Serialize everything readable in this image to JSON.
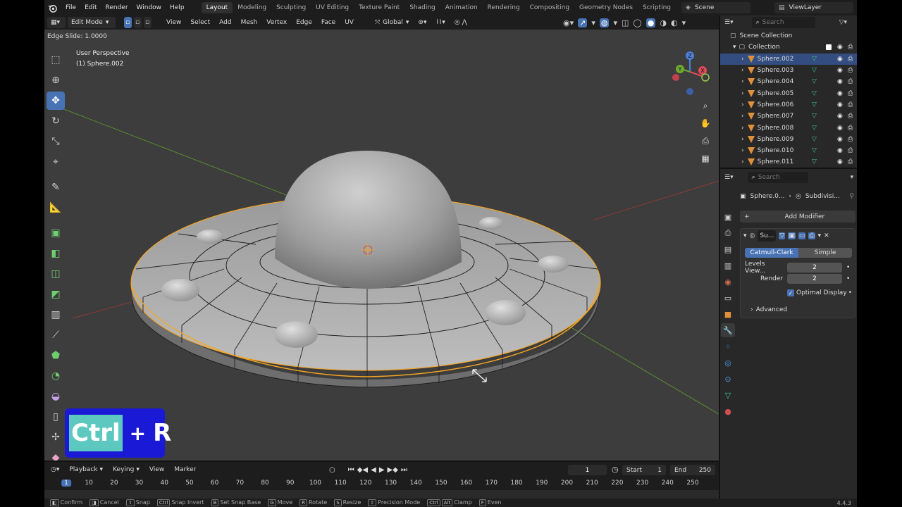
{
  "app": {
    "menus": [
      "File",
      "Edit",
      "Render",
      "Window",
      "Help"
    ],
    "workspace_tabs": [
      "Layout",
      "Modeling",
      "Sculpting",
      "UV Editing",
      "Texture Paint",
      "Shading",
      "Animation",
      "Rendering",
      "Compositing",
      "Geometry Nodes",
      "Scripting"
    ],
    "active_tab": "Layout",
    "add_tab_label": "+",
    "scene": "Scene",
    "view_layer": "ViewLayer"
  },
  "viewport_header": {
    "mode": "Edit Mode",
    "menus": [
      "View",
      "Select",
      "Add",
      "Mesh",
      "Vertex",
      "Edge",
      "Face",
      "UV"
    ],
    "orientation": "Global"
  },
  "viewport": {
    "operator_status": "Edge Slide: 1.0000",
    "perspective": "User Perspective",
    "object_info": "(1) Sphere.002",
    "gizmo_axes": [
      "X",
      "Y",
      "Z"
    ]
  },
  "shortcut_overlay": {
    "key1": "Ctrl",
    "plus": "+",
    "key2": "R"
  },
  "outliner": {
    "search_placeholder": "Search",
    "scene_collection": "Scene Collection",
    "collection": "Collection",
    "objects": [
      "Sphere.002",
      "Sphere.003",
      "Sphere.004",
      "Sphere.005",
      "Sphere.006",
      "Sphere.007",
      "Sphere.008",
      "Sphere.009",
      "Sphere.010",
      "Sphere.011"
    ],
    "selected_object": "Sphere.002"
  },
  "properties": {
    "search_placeholder": "Search",
    "breadcrumb_object": "Sphere.0...",
    "breadcrumb_modifier": "Subdivisi...",
    "add_modifier": "Add Modifier",
    "modifier_name": "Su...",
    "algorithm_options": [
      "Catmull-Clark",
      "Simple"
    ],
    "algorithm_selected": "Catmull-Clark",
    "levels_viewport_label": "Levels View...",
    "levels_viewport": "2",
    "render_label": "Render",
    "render_levels": "2",
    "optimal_display_label": "Optimal Display",
    "optimal_display_checked": true,
    "advanced_label": "Advanced"
  },
  "timeline": {
    "menus": [
      "Playback",
      "Keying",
      "View",
      "Marker"
    ],
    "current_frame": "1",
    "start_label": "Start",
    "start": "1",
    "end_label": "End",
    "end": "250",
    "ruler_ticks": [
      "1",
      "10",
      "20",
      "30",
      "40",
      "50",
      "60",
      "70",
      "80",
      "90",
      "100",
      "110",
      "120",
      "130",
      "140",
      "150",
      "160",
      "170",
      "180",
      "190",
      "200",
      "210",
      "220",
      "230",
      "240",
      "250"
    ]
  },
  "status_bar": {
    "items": [
      "Confirm",
      "Cancel",
      "Snap",
      "Snap Invert",
      "Set Snap Base",
      "Move",
      "Rotate",
      "Resize",
      "Precision Mode",
      "Clamp",
      "Even"
    ],
    "keys": [
      "Ctrl",
      "B",
      "Ctrl",
      "Alt",
      "F"
    ],
    "version": "4.4.3"
  },
  "colors": {
    "accent_blue": "#4772b3",
    "selection_orange": "#f5a623",
    "viewport_bg": "#3d3d3d",
    "overlay_bg": "#1a1ad6",
    "overlay_key_bg": "#5cc8c0",
    "mesh_icon": "#e0903a",
    "modifier_icon": "#3ec38c"
  },
  "icons": [
    "blender-logo-icon",
    "cursor-icon",
    "move-icon",
    "rotate-icon",
    "scale-icon",
    "transform-icon",
    "annotate-icon",
    "measure-icon",
    "extrude-icon",
    "inset-icon",
    "bevel-icon",
    "loopcut-icon",
    "knife-icon",
    "polybuild-icon",
    "spin-icon",
    "smooth-icon",
    "edge-slide-icon",
    "shrink-icon",
    "shear-icon",
    "zoom-icon",
    "hand-icon",
    "camera-icon",
    "grid-icon",
    "eye-icon",
    "camera-restrict-icon",
    "wrench-icon",
    "filter-icon"
  ]
}
